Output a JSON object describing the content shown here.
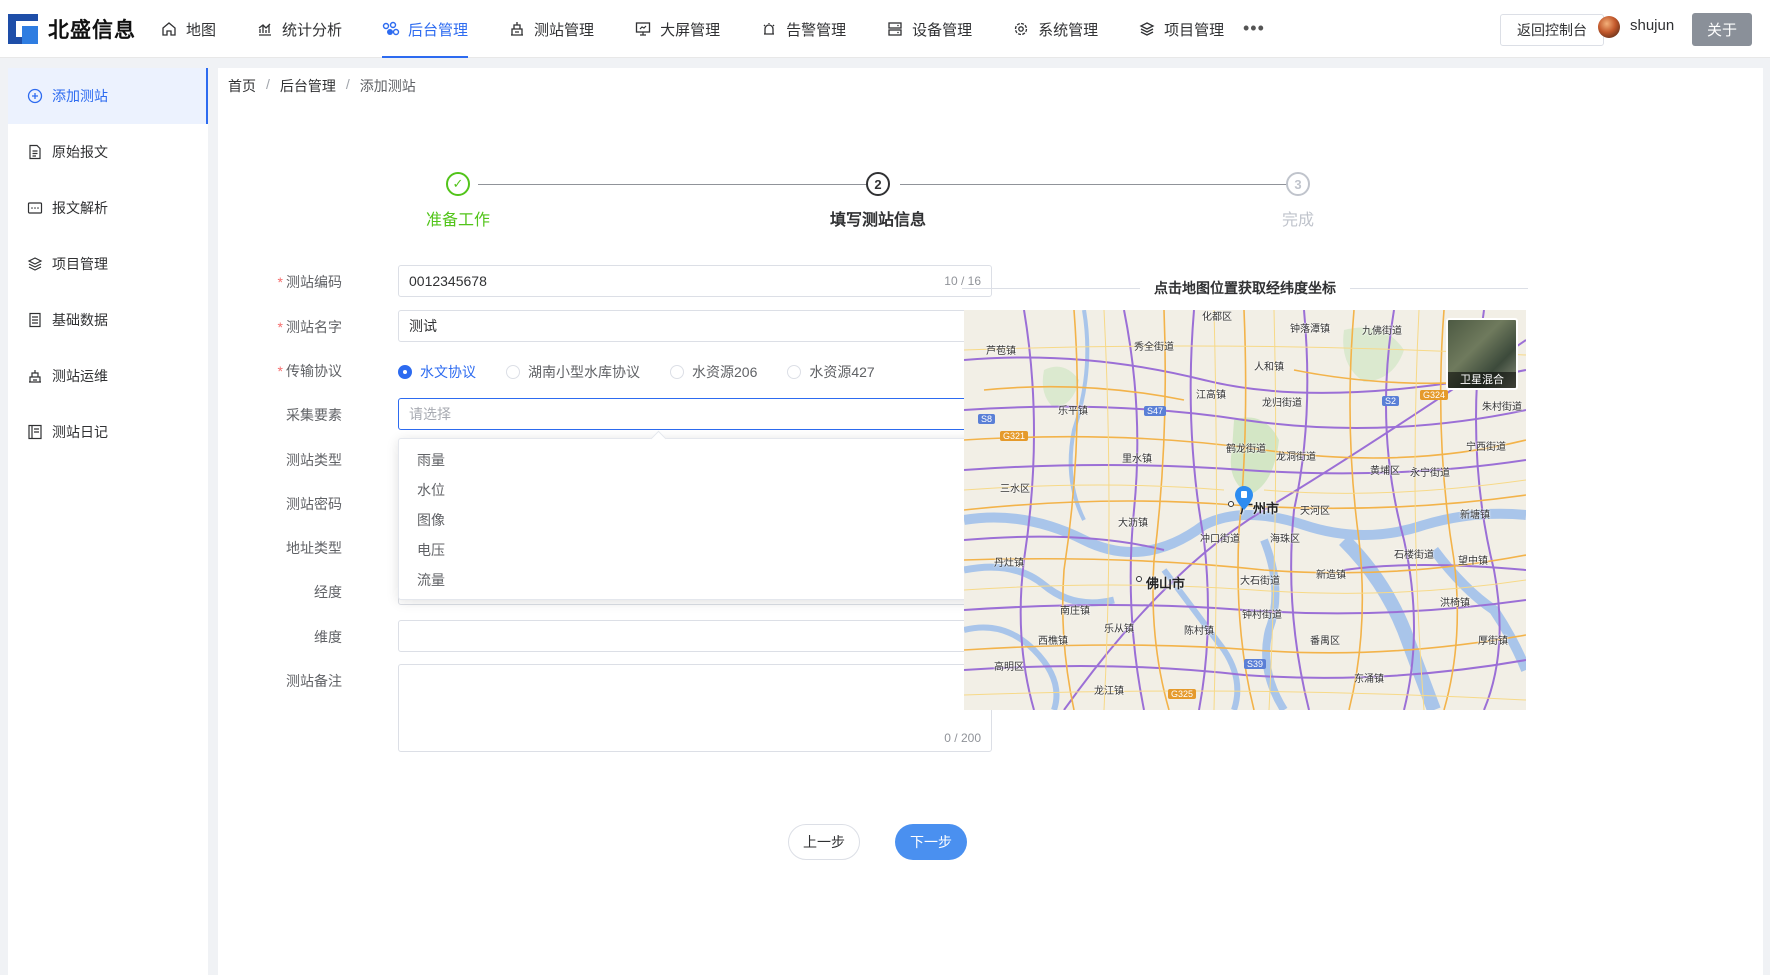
{
  "app": {
    "brand": "北盛信息"
  },
  "nav": {
    "items": [
      {
        "label": "地图",
        "icon": "home-icon"
      },
      {
        "label": "统计分析",
        "icon": "chart-icon"
      },
      {
        "label": "后台管理",
        "icon": "admin-icon",
        "active": true
      },
      {
        "label": "测站管理",
        "icon": "station-icon"
      },
      {
        "label": "大屏管理",
        "icon": "monitor-icon"
      },
      {
        "label": "告警管理",
        "icon": "alarm-icon"
      },
      {
        "label": "设备管理",
        "icon": "server-icon"
      },
      {
        "label": "系统管理",
        "icon": "gear-icon"
      },
      {
        "label": "项目管理",
        "icon": "layers-icon"
      }
    ],
    "more": "•••"
  },
  "header": {
    "console_label": "返回控制台",
    "username": "shujun",
    "about_label": "关于"
  },
  "sidebar": {
    "items": [
      {
        "label": "添加测站",
        "icon": "add-circle-icon",
        "active": true
      },
      {
        "label": "原始报文",
        "icon": "document-icon"
      },
      {
        "label": "报文解析",
        "icon": "parse-icon"
      },
      {
        "label": "项目管理",
        "icon": "layers-icon"
      },
      {
        "label": "基础数据",
        "icon": "data-icon"
      },
      {
        "label": "测站运维",
        "icon": "maintenance-icon"
      },
      {
        "label": "测站日记",
        "icon": "log-icon"
      }
    ]
  },
  "breadcrumb": [
    "首页",
    "后台管理",
    "添加测站"
  ],
  "steps": [
    {
      "index": "✓",
      "title": "准备工作",
      "status": "finish"
    },
    {
      "index": "2",
      "title": "填写测站信息",
      "status": "process"
    },
    {
      "index": "3",
      "title": "完成",
      "status": "wait"
    }
  ],
  "form": {
    "code": {
      "label": "测站编码",
      "value": "0012345678",
      "count": "10 / 16"
    },
    "name": {
      "label": "测站名字",
      "value": "测试"
    },
    "protocol": {
      "label": "传输协议",
      "options": [
        "水文协议",
        "湖南小型水库协议",
        "水资源206",
        "水资源427"
      ],
      "selected": "水文协议"
    },
    "elements": {
      "label": "采集要素",
      "placeholder": "请选择"
    },
    "type": {
      "label": "测站类型"
    },
    "password": {
      "label": "测站密码"
    },
    "address_type": {
      "label": "地址类型"
    },
    "longitude": {
      "label": "经度"
    },
    "latitude": {
      "label": "维度"
    },
    "remark": {
      "label": "测站备注",
      "count": "0 / 200"
    }
  },
  "dropdown": {
    "options": [
      "雨量",
      "水位",
      "图像",
      "电压",
      "流量"
    ]
  },
  "map": {
    "title": "点击地图位置获取经纬度坐标",
    "satellite_label": "卫星混合",
    "labels": {
      "huadu": "化都区",
      "zhongluotan": "钟落潭镇",
      "jiulong": "九佛街道",
      "lutang": "芦苞镇",
      "xiuquan": "秀全街道",
      "renhe": "人和镇",
      "jianggao": "江高镇",
      "lepin": "乐平镇",
      "longgui": "龙归街道",
      "zhucun": "朱村街道",
      "helong": "鹤龙街道",
      "longdong": "龙洞街道",
      "ningxi": "宁西街道",
      "lishui": "里水镇",
      "huangpu": "黄埔区",
      "yongning": "永宁街道",
      "sanshui": "三水区",
      "guangzhou": "广州市",
      "tianhe": "天河区",
      "dali": "大沥镇",
      "xintang": "新塘镇",
      "chongkou": "冲口街道",
      "haizhu": "海珠区",
      "danzao": "丹灶镇",
      "foshan": "佛山市",
      "dashi": "大石街道",
      "shiqiao": "石楼街道",
      "wangzhong": "望中镇",
      "xinzao": "新造镇",
      "hongqiao": "洪椅镇",
      "nanzhuang": "南庄镇",
      "zhongcun": "钟村街道",
      "leping2": "乐从镇",
      "chencun": "陈村镇",
      "panyu": "番禺区",
      "xiqiao": "西樵镇",
      "dongchong": "厚街镇",
      "gaoming": "高明区",
      "longjiang": "龙江镇",
      "dongyong": "东涌镇"
    },
    "roads": [
      "S8",
      "G321",
      "S47",
      "S2",
      "G324",
      "S39",
      "G325"
    ]
  },
  "buttons": {
    "prev": "上一步",
    "next": "下一步"
  },
  "colors": {
    "primary": "#2d6bf0",
    "success": "#52c41a",
    "danger": "#f56c6c"
  }
}
